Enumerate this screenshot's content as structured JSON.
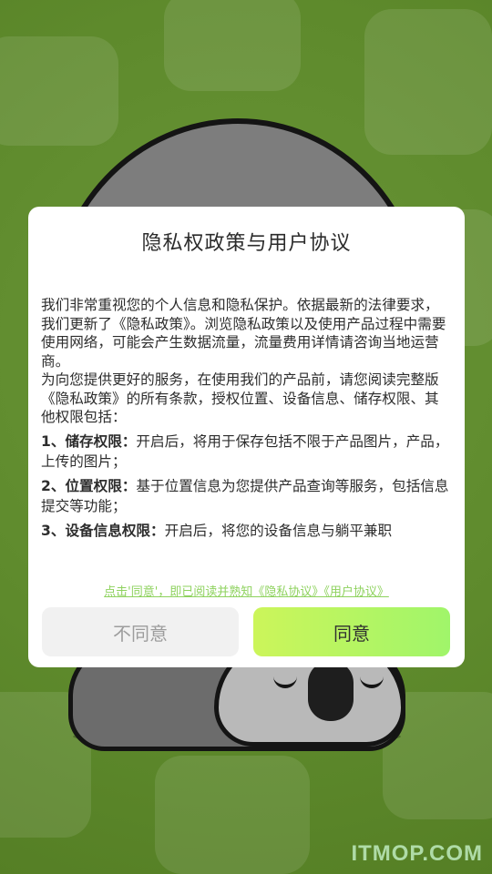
{
  "dialog": {
    "title": "隐私权政策与用户协议",
    "paragraphs": [
      "我们非常重视您的个人信息和隐私保护。依据最新的法律要求，我们更新了《隐私政策》。浏览隐私政策以及使用产品过程中需要使用网络，可能会产生数据流量，流量费用详情请咨询当地运营商。",
      "为向您提供更好的服务，在使用我们的产品前，请您阅读完整版《隐私政策》的所有条款，授权位置、设备信息、储存权限、其他权限包括："
    ],
    "items": [
      {
        "label": "1、储存权限：",
        "text": "开启后，将用于保存包括不限于产品图片，产品，上传的图片；"
      },
      {
        "label": "2、位置权限：",
        "text": "基于位置信息为您提供产品查询等服务，包括信息提交等功能；"
      },
      {
        "label": "3、设备信息权限：",
        "text": "开启后，将您的设备信息与躺平兼职"
      }
    ],
    "notice": "点击'同意'，即已阅读并熟知《隐私协议》《用户协议》",
    "disagree_label": "不同意",
    "agree_label": "同意"
  },
  "watermark": "ITMOP.COM",
  "colors": {
    "background": "#5e8a2c",
    "notice": "#8ed25e",
    "agree_gradient_start": "#ccf55a",
    "agree_gradient_end": "#a0f56a",
    "disagree_bg": "#f1f1f1"
  },
  "icons": [
    "koala-illustration"
  ]
}
